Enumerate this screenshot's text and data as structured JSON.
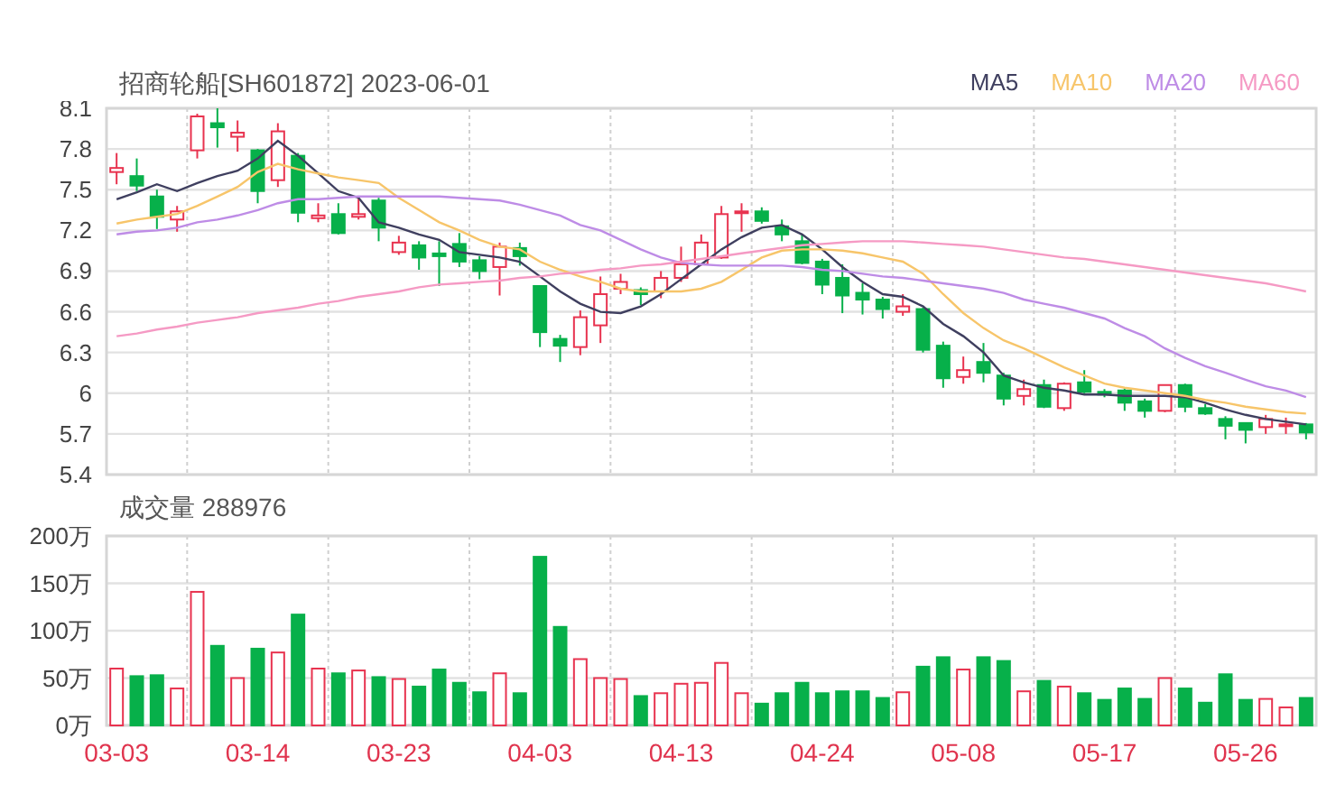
{
  "price_chart": {
    "chart_data": {
      "type": "candlestick",
      "title": "招商轮船[SH601872] 2023-06-01",
      "grid": true,
      "ylim": [
        5.4,
        8.1
      ],
      "categories": [
        null,
        null,
        null,
        null,
        null,
        null,
        null,
        null,
        null,
        null,
        null,
        null,
        null,
        null,
        null,
        null,
        null,
        null,
        null,
        null,
        null,
        null,
        null,
        null,
        null,
        null,
        null,
        null,
        null,
        null,
        null,
        null,
        null,
        null,
        null,
        null,
        null,
        null,
        null,
        null,
        null,
        null,
        null,
        null,
        null,
        null,
        null,
        null,
        null,
        null,
        null,
        null,
        null,
        null,
        null,
        null,
        null,
        null,
        null,
        null
      ],
      "yticks": [
        5.4,
        5.7,
        6,
        6.3,
        6.6,
        6.9,
        7.2,
        7.5,
        7.8,
        8.1
      ],
      "series": [
        {
          "name": "MA5",
          "type": "line",
          "color": "#3f3f5f",
          "values": [
            7.43,
            7.48,
            7.54,
            7.49,
            7.55,
            7.6,
            7.64,
            7.73,
            7.86,
            7.75,
            7.62,
            7.49,
            7.44,
            7.26,
            7.22,
            7.17,
            7.13,
            7.04,
            7.02,
            7,
            6.97,
            6.86,
            6.75,
            6.66,
            6.6,
            6.59,
            6.64,
            6.73,
            6.84,
            6.95,
            7.06,
            7.15,
            7.22,
            7.24,
            7.17,
            7.06,
            6.93,
            6.82,
            6.73,
            6.71,
            6.64,
            6.51,
            6.42,
            6.3,
            6.13,
            6.08,
            6.04,
            6.02,
            5.99,
            5.99,
            5.98,
            5.98,
            5.98,
            5.97,
            5.93,
            5.88,
            5.84,
            5.81,
            5.79,
            5.77
          ]
        },
        {
          "name": "MA10",
          "type": "line",
          "color": "#f7c56a",
          "values": [
            7.25,
            7.28,
            7.3,
            7.32,
            7.38,
            7.45,
            7.52,
            7.63,
            7.69,
            7.65,
            7.62,
            7.59,
            7.57,
            7.55,
            7.44,
            7.35,
            7.26,
            7.2,
            7.13,
            7.08,
            7.06,
            6.97,
            6.91,
            6.86,
            6.82,
            6.77,
            6.75,
            6.75,
            6.75,
            6.77,
            6.82,
            6.91,
            7,
            7.05,
            7.06,
            7.06,
            7.05,
            7.03,
            7,
            6.97,
            6.88,
            6.73,
            6.59,
            6.48,
            6.39,
            6.33,
            6.26,
            6.19,
            6.13,
            6.07,
            6.04,
            6.02,
            6,
            5.98,
            5.95,
            5.93,
            5.9,
            5.88,
            5.86,
            5.85
          ]
        },
        {
          "name": "MA20",
          "type": "line",
          "color": "#be8ce6",
          "values": [
            7.17,
            7.19,
            7.2,
            7.22,
            7.26,
            7.28,
            7.31,
            7.35,
            7.4,
            7.43,
            7.43,
            7.44,
            7.45,
            7.45,
            7.45,
            7.45,
            7.45,
            7.44,
            7.43,
            7.42,
            7.39,
            7.35,
            7.31,
            7.24,
            7.2,
            7.13,
            7.06,
            7,
            6.96,
            6.95,
            6.94,
            6.94,
            6.94,
            6.94,
            6.93,
            6.91,
            6.9,
            6.88,
            6.86,
            6.85,
            6.83,
            6.81,
            6.79,
            6.77,
            6.74,
            6.69,
            6.66,
            6.63,
            6.59,
            6.55,
            6.48,
            6.42,
            6.33,
            6.26,
            6.2,
            6.15,
            6.1,
            6.05,
            6.02,
            5.97
          ]
        },
        {
          "name": "MA60",
          "type": "line",
          "color": "#f59ac4",
          "values": [
            6.42,
            6.44,
            6.47,
            6.49,
            6.52,
            6.54,
            6.56,
            6.59,
            6.61,
            6.63,
            6.66,
            6.68,
            6.71,
            6.73,
            6.75,
            6.78,
            6.8,
            6.81,
            6.82,
            6.83,
            6.85,
            6.86,
            6.88,
            6.89,
            6.91,
            6.92,
            6.94,
            6.95,
            6.97,
            6.99,
            7.01,
            7.03,
            7.05,
            7.07,
            7.09,
            7.1,
            7.11,
            7.12,
            7.12,
            7.12,
            7.11,
            7.1,
            7.09,
            7.08,
            7.06,
            7.04,
            7.02,
            7,
            6.99,
            6.97,
            6.95,
            6.93,
            6.91,
            6.89,
            6.87,
            6.85,
            6.83,
            6.81,
            6.78,
            6.75
          ]
        }
      ],
      "ohlc": [
        [
          7.63,
          7.77,
          7.54,
          7.66
        ],
        [
          7.6,
          7.73,
          7.49,
          7.53
        ],
        [
          7.45,
          7.5,
          7.21,
          7.3
        ],
        [
          7.28,
          7.38,
          7.19,
          7.34
        ],
        [
          7.79,
          8.06,
          7.73,
          8.04
        ],
        [
          7.99,
          8.1,
          7.81,
          7.96
        ],
        [
          7.89,
          8.01,
          7.78,
          7.92
        ],
        [
          7.79,
          7.8,
          7.4,
          7.49
        ],
        [
          7.57,
          7.99,
          7.52,
          7.93
        ],
        [
          7.75,
          7.77,
          7.26,
          7.33
        ],
        [
          7.29,
          7.4,
          7.26,
          7.31
        ],
        [
          7.32,
          7.4,
          7.17,
          7.18
        ],
        [
          7.3,
          7.44,
          7.28,
          7.32
        ],
        [
          7.42,
          7.44,
          7.12,
          7.22
        ],
        [
          7.04,
          7.16,
          7.02,
          7.11
        ],
        [
          7.09,
          7.12,
          6.91,
          7
        ],
        [
          7.03,
          7.12,
          6.79,
          7.01
        ],
        [
          7.1,
          7.18,
          6.93,
          6.97
        ],
        [
          6.98,
          7.01,
          6.84,
          6.9
        ],
        [
          6.93,
          7.11,
          6.72,
          7.08
        ],
        [
          7.07,
          7.11,
          6.94,
          7.01
        ],
        [
          6.79,
          6.79,
          6.34,
          6.45
        ],
        [
          6.4,
          6.43,
          6.23,
          6.35
        ],
        [
          6.34,
          6.61,
          6.28,
          6.56
        ],
        [
          6.5,
          6.86,
          6.37,
          6.73
        ],
        [
          6.77,
          6.88,
          6.73,
          6.82
        ],
        [
          6.76,
          6.78,
          6.65,
          6.73
        ],
        [
          6.75,
          6.9,
          6.7,
          6.85
        ],
        [
          6.85,
          7.08,
          6.82,
          6.95
        ],
        [
          6.95,
          7.17,
          6.94,
          7.11
        ],
        [
          7,
          7.38,
          6.99,
          7.32
        ],
        [
          7.33,
          7.4,
          7.19,
          7.34
        ],
        [
          7.34,
          7.37,
          7.25,
          7.27
        ],
        [
          7.23,
          7.28,
          7.12,
          7.17
        ],
        [
          7.12,
          7.17,
          6.95,
          6.96
        ],
        [
          6.97,
          6.99,
          6.73,
          6.8
        ],
        [
          6.85,
          6.95,
          6.59,
          6.72
        ],
        [
          6.74,
          6.81,
          6.58,
          6.69
        ],
        [
          6.69,
          6.71,
          6.55,
          6.62
        ],
        [
          6.6,
          6.73,
          6.57,
          6.64
        ],
        [
          6.62,
          6.63,
          6.3,
          6.32
        ],
        [
          6.35,
          6.38,
          6.04,
          6.11
        ],
        [
          6.12,
          6.27,
          6.07,
          6.17
        ],
        [
          6.23,
          6.37,
          6.08,
          6.15
        ],
        [
          6.13,
          6.15,
          5.91,
          5.96
        ],
        [
          5.98,
          6.1,
          5.91,
          6.03
        ],
        [
          6.06,
          6.1,
          5.89,
          5.9
        ],
        [
          5.89,
          6.08,
          5.87,
          6.07
        ],
        [
          6.08,
          6.17,
          6,
          6.01
        ],
        [
          6.01,
          6.03,
          5.97,
          5.99
        ],
        [
          6.02,
          6.04,
          5.87,
          5.93
        ],
        [
          5.94,
          5.96,
          5.82,
          5.87
        ],
        [
          5.87,
          6.06,
          5.86,
          6.06
        ],
        [
          6.06,
          6.07,
          5.86,
          5.9
        ],
        [
          5.89,
          5.92,
          5.84,
          5.85
        ],
        [
          5.81,
          5.83,
          5.66,
          5.76
        ],
        [
          5.78,
          5.78,
          5.63,
          5.73
        ],
        [
          5.75,
          5.84,
          5.7,
          5.81
        ],
        [
          5.77,
          5.82,
          5.7,
          5.77
        ],
        [
          5.77,
          5.78,
          5.66,
          5.71
        ]
      ]
    }
  },
  "volume_chart": {
    "chart_data": {
      "type": "bar",
      "title": "成交量 288976",
      "grid": true,
      "ylim": [
        0,
        200
      ],
      "categories": [
        "03-03",
        null,
        null,
        null,
        null,
        null,
        null,
        "03-14",
        null,
        null,
        null,
        null,
        null,
        null,
        "03-23",
        null,
        null,
        null,
        null,
        null,
        null,
        "04-03",
        null,
        null,
        null,
        null,
        null,
        null,
        "04-13",
        null,
        null,
        null,
        null,
        null,
        null,
        "04-24",
        null,
        null,
        null,
        null,
        null,
        null,
        "05-08",
        null,
        null,
        null,
        null,
        null,
        null,
        "05-17",
        null,
        null,
        null,
        null,
        null,
        null,
        "05-26",
        null,
        null,
        null
      ],
      "yticks": [
        {
          "value": 0,
          "label": "0万"
        },
        {
          "value": 50,
          "label": "50万"
        },
        {
          "value": 100,
          "label": "100万"
        },
        {
          "value": 150,
          "label": "150万"
        },
        {
          "value": 200,
          "label": "200万"
        }
      ],
      "values": [
        60,
        52,
        53,
        39,
        141,
        84,
        50,
        81,
        77,
        117,
        60,
        55,
        58,
        51,
        49,
        41,
        59,
        45,
        35,
        55,
        34,
        178,
        104,
        70,
        50,
        49,
        31,
        34,
        44,
        45,
        66,
        34,
        23,
        34,
        45,
        34,
        36,
        36,
        29,
        35,
        62,
        72,
        59,
        72,
        68,
        36,
        47,
        41,
        34,
        27,
        39,
        28,
        50,
        39,
        24,
        54,
        27,
        28,
        19,
        29
      ]
    }
  }
}
